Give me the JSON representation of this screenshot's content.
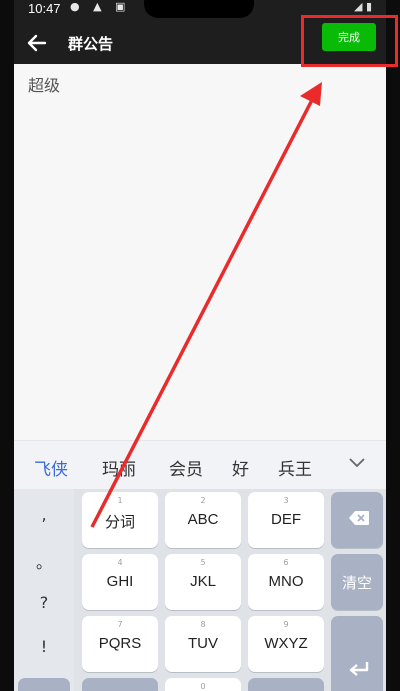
{
  "status_bar": {
    "time": "10:47",
    "icons": "● ▲ ▣",
    "right_text": "◢ ▮"
  },
  "header": {
    "back_icon": "back-arrow-icon",
    "title": "群公告",
    "done_label": "完成"
  },
  "editor": {
    "text": "超级"
  },
  "candidates": {
    "items": [
      "飞侠",
      "玛丽",
      "会员",
      "好",
      "兵王"
    ],
    "collapse_icon": "chevron-down-icon"
  },
  "keyboard": {
    "punctuation": [
      ",",
      "。",
      "?",
      "!"
    ],
    "keys": [
      {
        "num": "1",
        "label": "分词"
      },
      {
        "num": "2",
        "label": "ABC"
      },
      {
        "num": "3",
        "label": "DEF"
      },
      {
        "num": "4",
        "label": "GHI"
      },
      {
        "num": "5",
        "label": "JKL"
      },
      {
        "num": "6",
        "label": "MNO"
      },
      {
        "num": "7",
        "label": "PQRS"
      },
      {
        "num": "8",
        "label": "TUV"
      },
      {
        "num": "9",
        "label": "WXYZ"
      },
      {
        "num": "0",
        "label": ""
      }
    ],
    "backspace_icon": "backspace-icon",
    "clear_label": "清空",
    "enter_icon": "enter-icon"
  },
  "colors": {
    "done_button": "#09bb07",
    "annotation_red": "#e92b2b",
    "candidate_highlight": "#3a6bd8"
  }
}
